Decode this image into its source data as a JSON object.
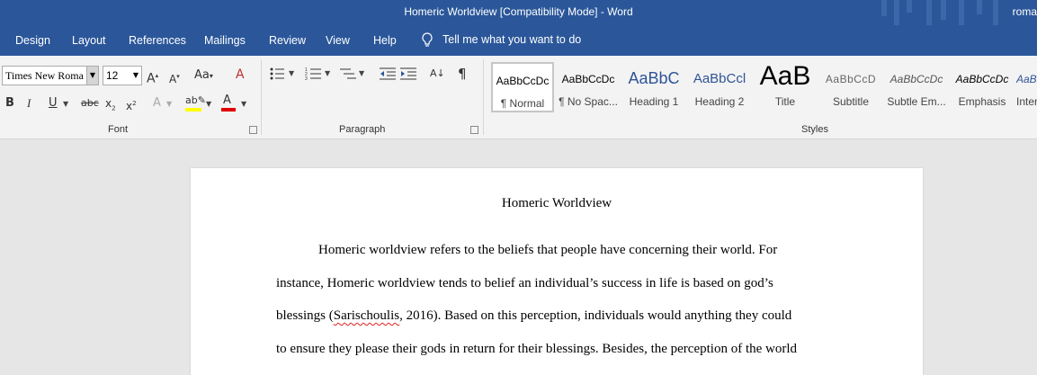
{
  "window": {
    "title": "Homeric Worldview [Compatibility Mode]  -  Word",
    "user": "roma"
  },
  "tabs": [
    "Design",
    "Layout",
    "References",
    "Mailings",
    "Review",
    "View",
    "Help"
  ],
  "tell_me": "Tell me what you want to do",
  "font": {
    "name": "Times New Roma",
    "size": "12",
    "group_label": "Font"
  },
  "paragraph": {
    "group_label": "Paragraph"
  },
  "styles": {
    "group_label": "Styles",
    "items": [
      {
        "sample": "AaBbCcDc",
        "name": "¶ Normal"
      },
      {
        "sample": "AaBbCcDc",
        "name": "¶ No Spac..."
      },
      {
        "sample": "AaBbC",
        "name": "Heading 1"
      },
      {
        "sample": "AaBbCcl",
        "name": "Heading 2"
      },
      {
        "sample": "AaB",
        "name": "Title"
      },
      {
        "sample": "AaBbCcD",
        "name": "Subtitle"
      },
      {
        "sample": "AaBbCcDc",
        "name": "Subtle Em..."
      },
      {
        "sample": "AaBbCcDc",
        "name": "Emphasis"
      },
      {
        "sample": "AaBbCcDc",
        "name": "Inten"
      }
    ]
  },
  "document": {
    "title": "Homeric Worldview",
    "lines": [
      "Homeric worldview refers to the beliefs that people have concerning their world. For",
      "instance, Homeric worldview tends to belief an individual’s success in life is based on god’s",
      {
        "before": "blessings (",
        "misspelled": "Sarischoulis",
        "after": ", 2016). Based on this perception, individuals would anything they could"
      },
      "to ensure they please their gods in return for their blessings. Besides, the perception of the world"
    ]
  },
  "colors": {
    "accent": "#2b579a",
    "ribbon": "#f3f3f3",
    "canvas": "#e6e6e6",
    "font_color_bar": "#e00000",
    "highlight_bar": "#ffff00"
  }
}
